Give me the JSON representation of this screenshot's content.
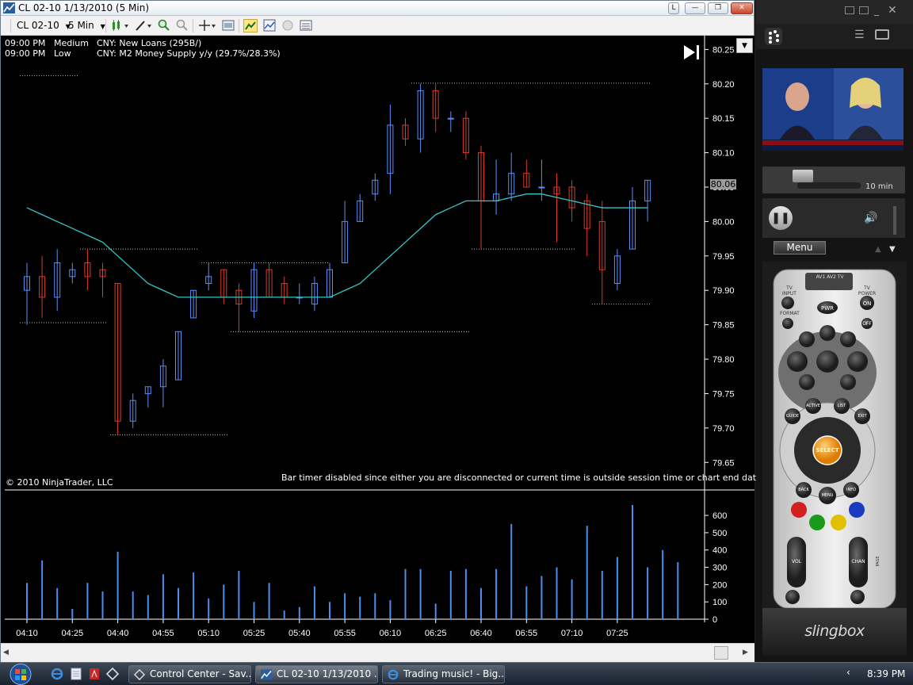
{
  "window": {
    "title": "CL 02-10  1/13/2010 (5 Min)",
    "buttons": {
      "layout": "L",
      "minimize": "—",
      "maximize": "❐",
      "close": "✕"
    }
  },
  "toolbar": {
    "instrument": "CL 02-10",
    "interval": "5 Min"
  },
  "events": [
    {
      "time": "09:00 PM",
      "importance": "Medium",
      "text": "CNY: New Loans (295B/)"
    },
    {
      "time": "09:00 PM",
      "importance": "Low",
      "text": "CNY: M2 Money Supply y/y (29.7%/28.3%)"
    }
  ],
  "chart": {
    "copyright": "© 2010 NinjaTrader, LLC",
    "bar_timer": "Bar timer disabled since either you are disconnected or current time is outside session time or chart end date",
    "last_price": "80.06",
    "price_ticks": [
      "80.25",
      "80.20",
      "80.15",
      "80.10",
      "80.05",
      "80.00",
      "79.95",
      "79.90",
      "79.85",
      "79.80",
      "79.75",
      "79.70",
      "79.65"
    ],
    "volume_ticks": [
      "600",
      "500",
      "400",
      "300",
      "200",
      "100",
      "0"
    ],
    "time_ticks": [
      "04:10",
      "04:25",
      "04:40",
      "04:55",
      "05:10",
      "05:25",
      "05:40",
      "05:55",
      "06:10",
      "06:25",
      "06:40",
      "06:55",
      "07:10",
      "07:25"
    ],
    "colors": {
      "up": "#5b8ff9",
      "down": "#e0392b",
      "ma": "#34c6c9",
      "volume": "#4a8ef0"
    }
  },
  "chart_data": {
    "type": "candlestick",
    "ylim": [
      79.61,
      80.27
    ],
    "bars": [
      {
        "o": 79.9,
        "h": 79.94,
        "l": 79.85,
        "c": 79.92
      },
      {
        "o": 79.92,
        "h": 79.95,
        "l": 79.86,
        "c": 79.89
      },
      {
        "o": 79.89,
        "h": 79.96,
        "l": 79.87,
        "c": 79.94
      },
      {
        "o": 79.92,
        "h": 79.94,
        "l": 79.91,
        "c": 79.93
      },
      {
        "o": 79.94,
        "h": 79.96,
        "l": 79.9,
        "c": 79.92
      },
      {
        "o": 79.93,
        "h": 79.94,
        "l": 79.89,
        "c": 79.92
      },
      {
        "o": 79.91,
        "h": 79.91,
        "l": 79.69,
        "c": 79.71
      },
      {
        "o": 79.71,
        "h": 79.75,
        "l": 79.7,
        "c": 79.74
      },
      {
        "o": 79.75,
        "h": 79.76,
        "l": 79.73,
        "c": 79.76
      },
      {
        "o": 79.76,
        "h": 79.8,
        "l": 79.73,
        "c": 79.79
      },
      {
        "o": 79.77,
        "h": 79.84,
        "l": 79.77,
        "c": 79.84
      },
      {
        "o": 79.86,
        "h": 79.9,
        "l": 79.86,
        "c": 79.9
      },
      {
        "o": 79.91,
        "h": 79.94,
        "l": 79.9,
        "c": 79.92
      },
      {
        "o": 79.93,
        "h": 79.93,
        "l": 79.88,
        "c": 79.89
      },
      {
        "o": 79.9,
        "h": 79.91,
        "l": 79.84,
        "c": 79.88
      },
      {
        "o": 79.87,
        "h": 79.94,
        "l": 79.86,
        "c": 79.93
      },
      {
        "o": 79.93,
        "h": 79.94,
        "l": 79.89,
        "c": 79.89
      },
      {
        "o": 79.91,
        "h": 79.92,
        "l": 79.88,
        "c": 79.89
      },
      {
        "o": 79.89,
        "h": 79.91,
        "l": 79.88,
        "c": 79.89
      },
      {
        "o": 79.88,
        "h": 79.92,
        "l": 79.87,
        "c": 79.91
      },
      {
        "o": 79.89,
        "h": 79.94,
        "l": 79.89,
        "c": 79.93
      },
      {
        "o": 79.94,
        "h": 80.03,
        "l": 79.94,
        "c": 80.0
      },
      {
        "o": 80.0,
        "h": 80.04,
        "l": 80.0,
        "c": 80.03
      },
      {
        "o": 80.04,
        "h": 80.07,
        "l": 80.03,
        "c": 80.06
      },
      {
        "o": 80.07,
        "h": 80.17,
        "l": 80.04,
        "c": 80.14
      },
      {
        "o": 80.14,
        "h": 80.15,
        "l": 80.11,
        "c": 80.12
      },
      {
        "o": 80.12,
        "h": 80.2,
        "l": 80.1,
        "c": 80.19
      },
      {
        "o": 80.19,
        "h": 80.2,
        "l": 80.13,
        "c": 80.15
      },
      {
        "o": 80.15,
        "h": 80.16,
        "l": 80.13,
        "c": 80.15
      },
      {
        "o": 80.15,
        "h": 80.16,
        "l": 80.09,
        "c": 80.1
      },
      {
        "o": 80.1,
        "h": 80.11,
        "l": 79.96,
        "c": 80.03
      },
      {
        "o": 80.03,
        "h": 80.09,
        "l": 80.01,
        "c": 80.04
      },
      {
        "o": 80.04,
        "h": 80.1,
        "l": 80.03,
        "c": 80.07
      },
      {
        "o": 80.07,
        "h": 80.09,
        "l": 80.05,
        "c": 80.05
      },
      {
        "o": 80.05,
        "h": 80.09,
        "l": 80.03,
        "c": 80.05
      },
      {
        "o": 80.05,
        "h": 80.07,
        "l": 79.97,
        "c": 80.04
      },
      {
        "o": 80.05,
        "h": 80.06,
        "l": 80.0,
        "c": 80.02
      },
      {
        "o": 80.03,
        "h": 80.04,
        "l": 79.95,
        "c": 79.99
      },
      {
        "o": 80.0,
        "h": 80.03,
        "l": 79.88,
        "c": 79.93
      },
      {
        "o": 79.91,
        "h": 79.96,
        "l": 79.9,
        "c": 79.95
      },
      {
        "o": 79.96,
        "h": 80.05,
        "l": 79.96,
        "c": 80.03
      },
      {
        "o": 80.03,
        "h": 80.06,
        "l": 80.0,
        "c": 80.06
      }
    ],
    "volume": [
      210,
      340,
      180,
      60,
      210,
      160,
      390,
      160,
      140,
      260,
      180,
      270,
      120,
      200,
      280,
      100,
      210,
      50,
      70,
      190,
      100,
      150,
      130,
      150,
      110,
      290,
      290,
      90,
      280,
      290,
      180,
      290,
      550,
      190,
      250,
      300,
      230,
      540,
      280,
      360,
      660,
      300,
      400,
      330
    ],
    "ma": [
      80.02,
      80.01,
      80.0,
      79.99,
      79.98,
      79.97,
      79.95,
      79.93,
      79.91,
      79.9,
      79.89,
      79.89,
      79.89,
      79.89,
      79.89,
      79.89,
      79.89,
      79.89,
      79.89,
      79.89,
      79.89,
      79.9,
      79.91,
      79.93,
      79.95,
      79.97,
      79.99,
      80.01,
      80.02,
      80.03,
      80.03,
      80.03,
      80.035,
      80.04,
      80.04,
      80.035,
      80.03,
      80.025,
      80.02,
      80.02,
      80.02,
      80.02
    ]
  },
  "sling": {
    "seek_label": "10 min",
    "menu_label": "Menu",
    "brand": "slingbox",
    "remote": {
      "tv_input": "TV INPUT",
      "tv_power": "TV POWER",
      "format": "FORMAT",
      "pwr": "PWR",
      "on": "ON",
      "off": "OFF",
      "select": "SELECT",
      "guide": "GUIDE",
      "active": "ACTIVE",
      "list": "LIST",
      "exit": "EXIT",
      "back": "BACK",
      "menu": "MENU",
      "info": "INFO",
      "vol": "VOL",
      "chan": "CHAN",
      "page": "PAGE",
      "av_switch": "AV1 AV2 TV"
    }
  },
  "taskbar": {
    "tasks": [
      {
        "label": "Control Center - Sav..."
      },
      {
        "label": "CL 02-10  1/13/2010 ..."
      },
      {
        "label": "Trading music! - Big..."
      }
    ],
    "clock": "8:39 PM"
  }
}
